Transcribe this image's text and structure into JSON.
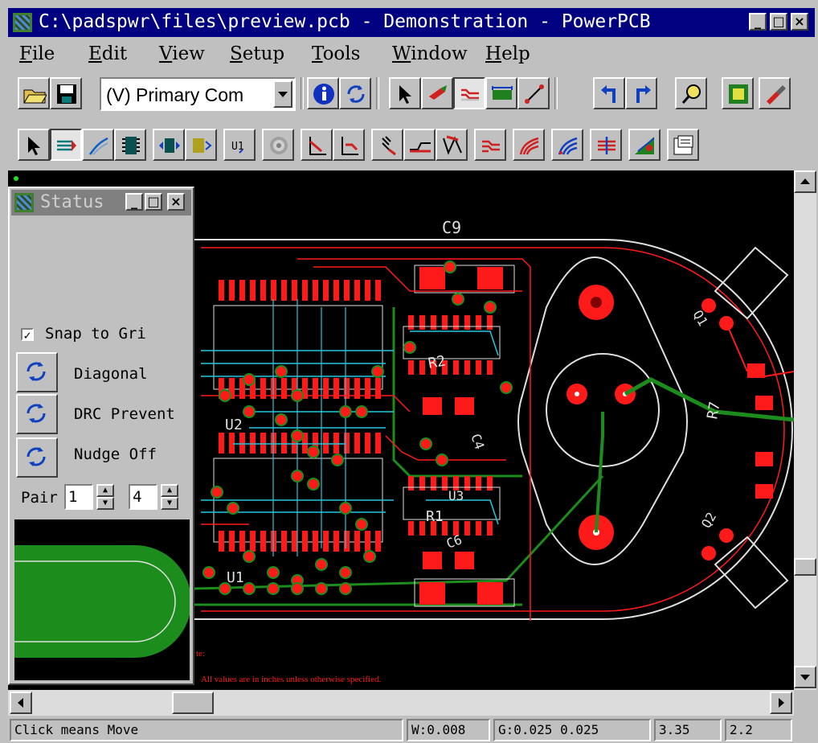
{
  "window": {
    "title": "C:\\padspwr\\files\\preview.pcb - Demonstration - PowerPCB",
    "controls": {
      "minimize": "_",
      "maximize": "□",
      "close": "×"
    }
  },
  "menu": [
    "File",
    "Edit",
    "View",
    "Setup",
    "Tools",
    "Window",
    "Help"
  ],
  "toolbar": {
    "layer_combo": "(V) Primary Com",
    "buttons": [
      "open-icon",
      "save-icon",
      "info-icon",
      "redraw-icon",
      "select-icon",
      "highlight-icon",
      "route-icon",
      "board-icon",
      "trace-icon",
      "undo-icon",
      "redo-icon",
      "zoom-icon",
      "report-icon",
      "paint-icon"
    ]
  },
  "toolbar2": {
    "buttons": [
      "select-mode-icon",
      "route-mode-icon",
      "sketch-icon",
      "component-icon",
      "move-icon",
      "swap-icon",
      "label-icon",
      "via-icon",
      "miter-icon",
      "trim-icon",
      "split-icon",
      "plane-icon",
      "clearance-icon",
      "fanout-icon",
      "channel-icon",
      "spread-icon",
      "length-icon",
      "dimension-icon"
    ]
  },
  "status_window": {
    "title": "Status",
    "snap_label": "Snap to Gri",
    "snap_checked": true,
    "options": [
      "Diagonal",
      "DRC Prevent",
      "Nudge Off"
    ],
    "pair_label": "Pair",
    "pair_value_1": "1",
    "pair_value_2": "4"
  },
  "board": {
    "labels": {
      "c9": "C9",
      "r2": "R2",
      "r7": "R7",
      "r1": "R1",
      "c6": "C6",
      "c4": "C4",
      "u1": "U1",
      "u2": "U2",
      "u3": "U3",
      "q1": "Q1",
      "q2": "Q2"
    },
    "note_1": "te:",
    "note_2": "All values are in inches unless otherwise specified."
  },
  "statusbar": {
    "message": "Click means Move",
    "width": "W:0.008",
    "grid": "G:0.025 0.025",
    "x": "3.35",
    "y": "2.2"
  },
  "colors": {
    "titlebar": "#000080",
    "canvas": "#000000",
    "copper_red": "#ff1a1a",
    "copper_green": "#1c8c1c",
    "trace_cyan": "#22c8e0",
    "outline": "#e0e0e0"
  }
}
